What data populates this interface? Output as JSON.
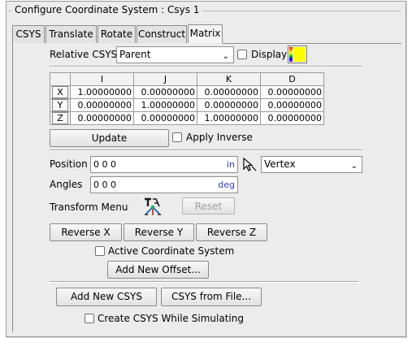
{
  "dialog": {
    "title": "Configure Coordinate System : Csys 1"
  },
  "tabs": [
    {
      "label": "CSYS"
    },
    {
      "label": "Translate"
    },
    {
      "label": "Rotate"
    },
    {
      "label": "Construct"
    },
    {
      "label": "Matrix"
    }
  ],
  "active_tab": "Matrix",
  "relative_csys": {
    "label": "Relative CSYS",
    "value": "Parent"
  },
  "display": {
    "label": "Display",
    "checked": false,
    "swatch_color": "#ffff00"
  },
  "matrix": {
    "columns": [
      "",
      "I",
      "J",
      "K",
      "D"
    ],
    "rows": [
      {
        "header": "X",
        "values": [
          "1.00000000",
          "0.00000000",
          "0.00000000",
          "0.00000000"
        ]
      },
      {
        "header": "Y",
        "values": [
          "0.00000000",
          "1.00000000",
          "0.00000000",
          "0.00000000"
        ]
      },
      {
        "header": "Z",
        "values": [
          "0.00000000",
          "0.00000000",
          "1.00000000",
          "0.00000000"
        ]
      }
    ]
  },
  "update_button": "Update",
  "apply_inverse": {
    "label": "Apply Inverse",
    "checked": false
  },
  "position": {
    "label": "Position",
    "value": "0 0 0",
    "unit": "in"
  },
  "pick_mode": {
    "value": "Vertex"
  },
  "angles": {
    "label": "Angles",
    "value": "0 0 0",
    "unit": "deg"
  },
  "transform_menu": {
    "label": "Transform Menu"
  },
  "reset_button": "Reset",
  "reverse_buttons": [
    "Reverse X",
    "Reverse Y",
    "Reverse Z"
  ],
  "active_cs": {
    "label": "Active Coordinate System",
    "checked": false
  },
  "add_offset_button": "Add New Offset...",
  "add_csys_button": "Add New CSYS",
  "csys_from_file_button": "CSYS from File...",
  "create_while_sim": {
    "label": "Create CSYS While Simulating",
    "checked": false
  }
}
